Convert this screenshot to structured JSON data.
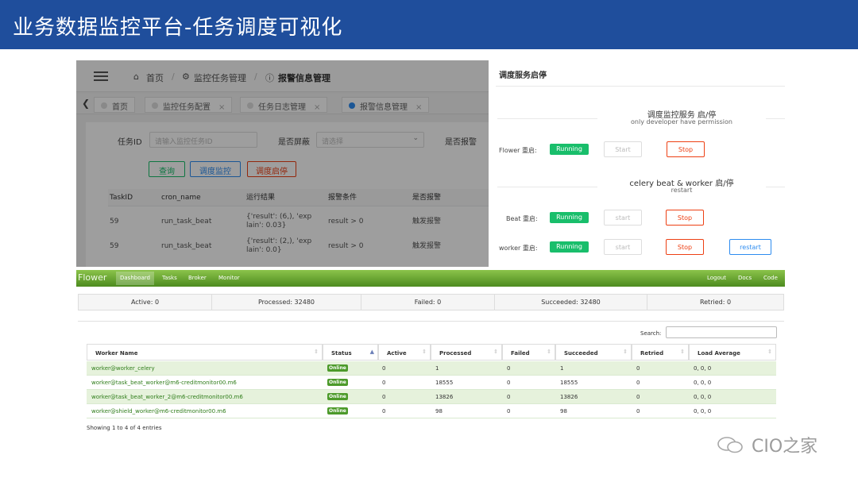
{
  "slide_title": "业务数据监控平台-任务调度可视化",
  "admin": {
    "breadcrumb": [
      "首页",
      "监控任务管理",
      "报警信息管理"
    ],
    "tabs": [
      {
        "label": "首页",
        "active": false
      },
      {
        "label": "监控任务配置",
        "active": false
      },
      {
        "label": "任务日志管理",
        "active": false
      },
      {
        "label": "报警信息管理",
        "active": true
      }
    ],
    "filters": {
      "task_id_label": "任务ID",
      "task_id_placeholder": "请输入监控任务ID",
      "shield_label": "是否屏蔽",
      "shield_placeholder": "请选择",
      "alarm_label": "是否报警"
    },
    "buttons": {
      "query": "查询",
      "schedule_monitor": "调度监控",
      "schedule_toggle": "调度启停"
    },
    "columns": [
      "TaskID",
      "cron_name",
      "运行结果",
      "报警条件",
      "是否报警"
    ],
    "rows": [
      {
        "task_id": "59",
        "cron_name": "run_task_beat",
        "result_l1": "{'result': (6,), 'exp",
        "result_l2": "lain': 0.03}",
        "condition": "result > 0",
        "alarm": "触发报警"
      },
      {
        "task_id": "59",
        "cron_name": "run_task_beat",
        "result_l1": "{'result': (2,), 'exp",
        "result_l2": "lain': 0.0}",
        "condition": "result > 0",
        "alarm": "触发报警"
      }
    ]
  },
  "service": {
    "title": "调度服务启停",
    "section1_head": "调度监控服务 启/停",
    "section1_sub": "only developer have permission",
    "section2_head": "celery beat & worker 启/停",
    "section2_sub": "restart",
    "flower_label": "Flower 重启:",
    "beat_label": "Beat 重启:",
    "worker_label": "worker 重启:",
    "running": "Running",
    "start_cap": "Start",
    "start_low": "start",
    "stop": "Stop",
    "restart": "restart"
  },
  "flower": {
    "brand": "Flower",
    "nav": [
      "Dashboard",
      "Tasks",
      "Broker",
      "Monitor"
    ],
    "nav_right": [
      "Logout",
      "Docs",
      "Code"
    ],
    "stats": [
      "Active: 0",
      "Processed: 32480",
      "Failed: 0",
      "Succeeded: 32480",
      "Retried: 0"
    ],
    "search_label": "Search:",
    "columns": [
      "Worker Name",
      "Status",
      "Active",
      "Processed",
      "Failed",
      "Succeeded",
      "Retried",
      "Load Average"
    ],
    "workers": [
      {
        "name": "worker@worker_celery",
        "status": "Online",
        "active": "0",
        "processed": "1",
        "failed": "0",
        "succeeded": "1",
        "retried": "0",
        "load": "0, 0, 0"
      },
      {
        "name": "worker@task_beat_worker@m6-creditmonitor00.m6",
        "status": "Online",
        "active": "0",
        "processed": "18555",
        "failed": "0",
        "succeeded": "18555",
        "retried": "0",
        "load": "0, 0, 0"
      },
      {
        "name": "worker@task_beat_worker_2@m6-creditmonitor00.m6",
        "status": "Online",
        "active": "0",
        "processed": "13826",
        "failed": "0",
        "succeeded": "13826",
        "retried": "0",
        "load": "0, 0, 0"
      },
      {
        "name": "worker@shield_worker@m6-creditmonitor00.m6",
        "status": "Online",
        "active": "0",
        "processed": "98",
        "failed": "0",
        "succeeded": "98",
        "retried": "0",
        "load": "0, 0, 0"
      }
    ],
    "footer": "Showing 1 to 4 of 4 entries"
  },
  "watermark": "CIO之家",
  "colors": {
    "title_bar": "#1f4e9c",
    "running": "#19be6b",
    "stop": "#ed4014",
    "restart": "#2d8cf0",
    "flower_green": "#4c8b1f"
  }
}
